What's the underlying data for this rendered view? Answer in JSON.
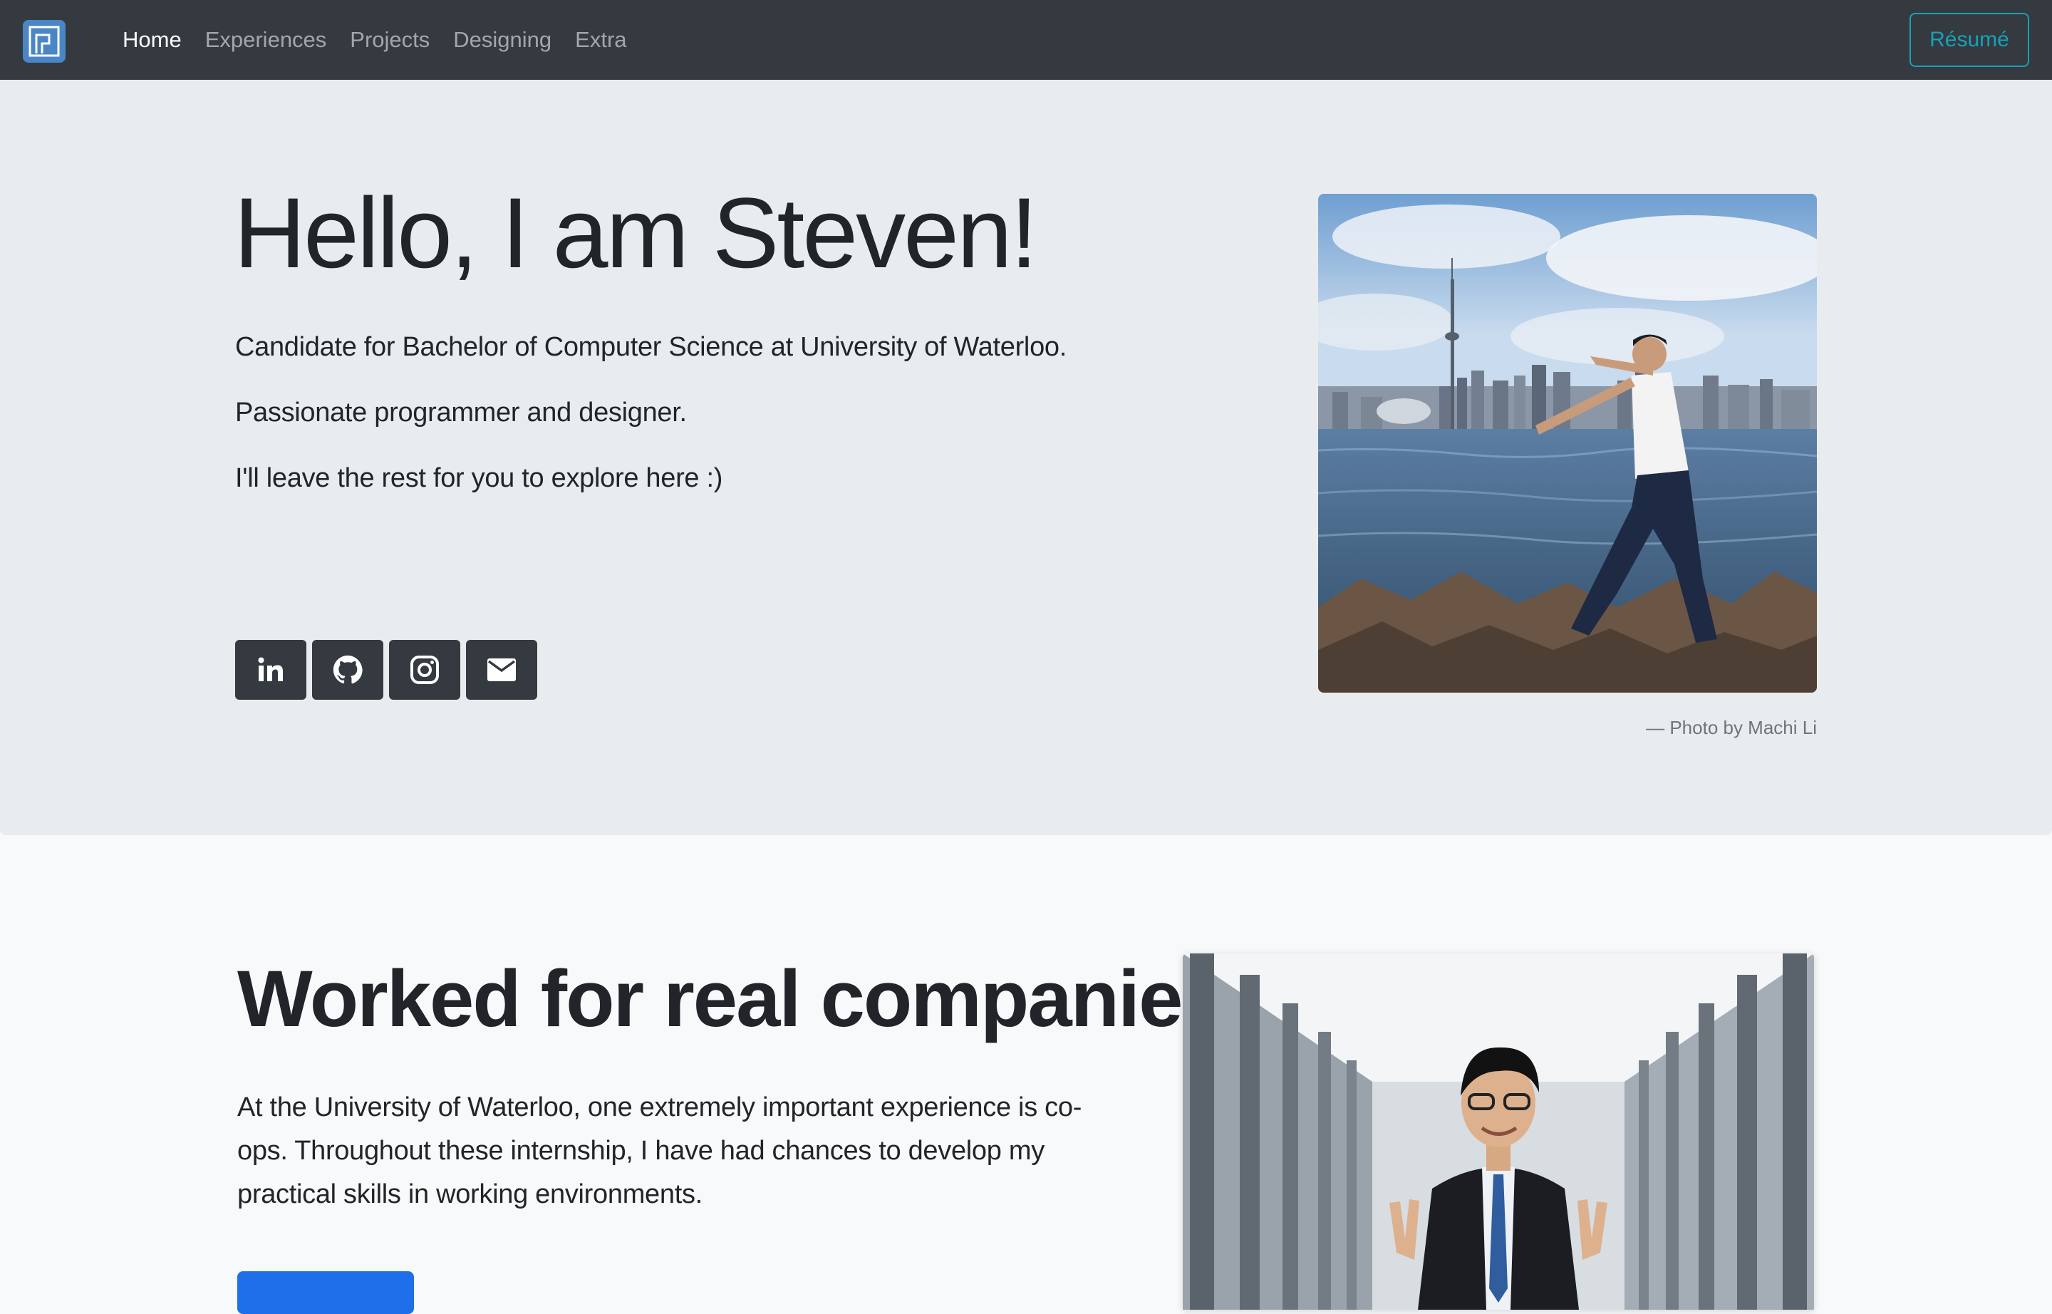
{
  "navbar": {
    "logo_icon": "site-logo-icon",
    "links": [
      {
        "label": "Home",
        "active": true
      },
      {
        "label": "Experiences",
        "active": false
      },
      {
        "label": "Projects",
        "active": false
      },
      {
        "label": "Designing",
        "active": false
      },
      {
        "label": "Extra",
        "active": false
      }
    ],
    "resume_label": "Résumé"
  },
  "hero": {
    "title": "Hello, I am Steven!",
    "lines": [
      "Candidate for Bachelor of Computer Science at University of Waterloo.",
      "Passionate programmer and designer.",
      "I'll leave the rest for you to explore here :)"
    ],
    "socials": [
      {
        "name": "linkedin-icon",
        "glyph": "in"
      },
      {
        "name": "github-icon",
        "glyph": ""
      },
      {
        "name": "instagram-icon",
        "glyph": ""
      },
      {
        "name": "email-icon",
        "glyph": ""
      }
    ],
    "photo_credit": "— Photo by Machi Li"
  },
  "experience": {
    "title": "Worked for real companies",
    "text": "At the University of Waterloo, one extremely important experience is co-ops. Throughout these internship, I have had chances to develop my practical skills in working environments."
  },
  "colors": {
    "navbar_bg": "#343a40",
    "hero_bg": "#e9ecef",
    "accent_teal": "#17a2b8",
    "primary_blue": "#1f6feb"
  }
}
